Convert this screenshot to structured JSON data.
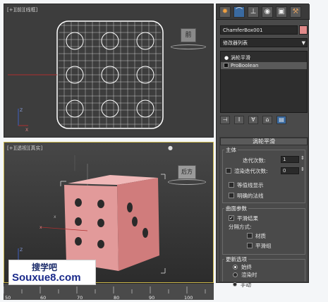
{
  "viewport_front": {
    "label": "[+][前][线框]"
  },
  "viewport_persp": {
    "label": "[+][透视][真实]"
  },
  "viewcube": {
    "front_face": "前",
    "persp_face": "后方"
  },
  "panel": {
    "tabs": [
      "sun-icon",
      "curve-icon",
      "hierarchy-icon",
      "motion-icon",
      "display-icon",
      "hammer-icon"
    ],
    "object_name": "ChamferBox001",
    "modifier_list": "修改器列表",
    "stack": [
      {
        "label": "涡轮平滑",
        "icon": "bulb-icon"
      },
      {
        "label": "ProBoolean",
        "icon": "square-icon"
      }
    ],
    "stack_buttons": [
      "pin-icon",
      "show-end-icon",
      "unique-icon",
      "remove-icon",
      "configure-icon"
    ]
  },
  "rollout": {
    "title": "涡轮平滑",
    "main": {
      "title": "主体",
      "iterations_label": "迭代次数:",
      "iterations_value": "1",
      "render_iters_label": "渲染迭代次数:",
      "render_iters_value": "0",
      "render_iters_checked": false,
      "isoline_label": "等值线显示",
      "isoline_checked": false,
      "explicit_normals_label": "明确的法线",
      "explicit_normals_checked": false
    },
    "surface": {
      "title": "曲面参数",
      "smooth_result_label": "平滑结果",
      "smooth_result_checked": true,
      "separate_label": "分隔方式:",
      "materials_label": "材质",
      "smoothing_groups_label": "平滑组"
    },
    "update": {
      "title": "更新选项",
      "options": [
        "始终",
        "渲染时",
        "手动"
      ],
      "selected": 0
    }
  },
  "timeline": {
    "ticks": [
      "50",
      "60",
      "70",
      "80",
      "90",
      "100"
    ]
  },
  "watermark": {
    "line1": "搜学吧",
    "line2": "Souxue8.com"
  },
  "colors": {
    "dice": "#e29a9a",
    "pips": "#2a2a2a",
    "swatch": "#e08a8a",
    "active_border": "#c9b54a"
  }
}
